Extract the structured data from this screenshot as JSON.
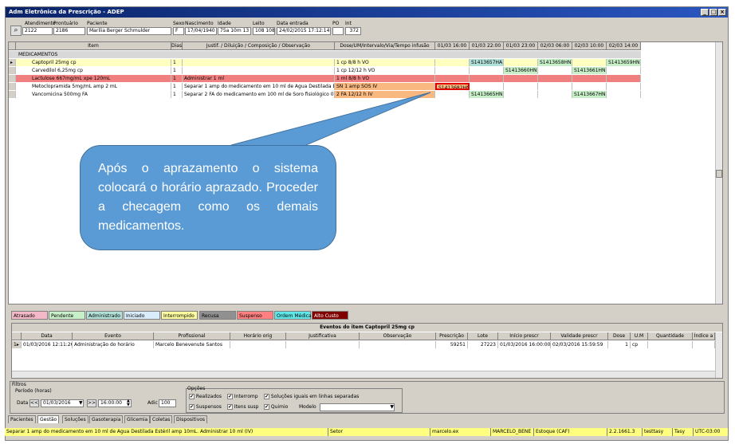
{
  "window": {
    "title": "Adm Eletrônica da Prescrição - ADEP"
  },
  "patient": {
    "labels": {
      "atendimento": "Atendimento",
      "prontuario": "Prontuário",
      "paciente": "Paciente",
      "sexo": "Sexo",
      "nascimento": "Nascimento",
      "idade": "Idade",
      "leito": "Leito",
      "data_entrada": "Data entrada",
      "po": "PO",
      "int": "Int"
    },
    "atendimento": "2122",
    "prontuario": "2186",
    "paciente": "Marilia Berger Schmulder",
    "sexo": "F",
    "nascimento": "17/04/1940",
    "idade": "75a 10m 13",
    "leito": "108 108",
    "data_entrada": "24/02/2015 17:12:14",
    "po": "",
    "int": "372"
  },
  "grid": {
    "columns": [
      "Item",
      "Dias",
      "Justif. / Diluição / Composição / Observação",
      "Dose/UM/Intervalo/Via/Tempo infusão",
      "01/03 16:00",
      "01/03 22:00",
      "01/03 23:00",
      "02/03 06:00",
      "02/03 10:00",
      "02/03 14:00"
    ],
    "group": "MEDICAMENTOS",
    "rows": [
      {
        "item": "Captopril 25mg cp",
        "dias": "1",
        "justif": "",
        "dose": "1 cp  8/8 h  VO",
        "h1": "",
        "h2": "S1413657HA",
        "h3": "",
        "h4": "S1413658HN",
        "h5": "",
        "h6": "S1413659HN"
      },
      {
        "item": "Carvedilol 6,25mg cp",
        "dias": "1",
        "justif": "",
        "dose": "1 cp  12/12 h  VO",
        "h1": "",
        "h2": "",
        "h3": "S1413660HN",
        "h4": "",
        "h5": "S1413661HN",
        "h6": ""
      },
      {
        "item": "Lactulose 667mg/mL xpe 120mL",
        "dias": "1",
        "justif": "Administrar 1 ml",
        "dose": "1 ml  8/8 h  VO",
        "h1": "",
        "h2": "",
        "h3": "",
        "h4": "",
        "h5": "",
        "h6": ""
      },
      {
        "item": "Metoclopramida 5mg/mL amp 2 mL",
        "dias": "1",
        "justif": "Separar 1 amp do medicamento em 10 ml de Agua Destilada Es",
        "dose": "SN 1 amp  SOS  IV",
        "h1": "S1413682HN",
        "h2": "",
        "h3": "",
        "h4": "",
        "h5": "",
        "h6": ""
      },
      {
        "item": "Vancomicina 500mg FA",
        "dias": "1",
        "justif": "Separar 2 FA do medicamento em 100 ml de Soro fisiológico 0,9",
        "dose": "2 FA  12/12 h  IV",
        "h1": "",
        "h2": "S1413665HN",
        "h3": "",
        "h4": "",
        "h5": "S1413667HN",
        "h6": ""
      }
    ]
  },
  "callout": {
    "text": "Após o aprazamento o sistema colocará o horário aprazado. Proceder a checagem como os demais medicamentos."
  },
  "legend": [
    {
      "label": "Atrasado",
      "color": "#f4b8c8"
    },
    {
      "label": "Pendente",
      "color": "#c8f0c8"
    },
    {
      "label": "Administrado",
      "color": "#b0e0d8"
    },
    {
      "label": "Iniciado",
      "color": "#d8ecfc"
    },
    {
      "label": "Interrompido",
      "color": "#ffffa0"
    },
    {
      "label": "Recusa",
      "color": "#909090"
    },
    {
      "label": "Suspenso",
      "color": "#ff8080"
    },
    {
      "label": "Ordem Médica",
      "color": "#60e8e8"
    },
    {
      "label": "Alto Custo",
      "color": "#800000"
    }
  ],
  "events": {
    "title": "Eventos do item Captopril 25mg cp",
    "columns": [
      "Data",
      "Evento",
      "Profissional",
      "Horário orig",
      "Justificativa",
      "Observação",
      "Prescrição",
      "Lote",
      "Início prescr",
      "Validade prescr",
      "Dose",
      "U.M",
      "Quantidade",
      "Índice a"
    ],
    "rows": [
      {
        "data": "01/03/2016 12:11:26",
        "evento": "Administração do horário",
        "profissional": "Marcelo Benevenute Santos",
        "horario": "",
        "justif": "",
        "obs": "",
        "prescricao": "59251",
        "lote": "27223",
        "inicio": "01/03/2016 16:00:00",
        "validade": "02/03/2016 15:59:59",
        "dose": "1",
        "um": "cp",
        "qtd": "",
        "indice": ""
      }
    ]
  },
  "filters": {
    "title": "Filtros",
    "period_label": "Período (horas)",
    "data_label": "Data",
    "date_value": "01/03/2016",
    "time_value": "16:00:00",
    "adic_label": "Adic",
    "adic_value": "100",
    "options_title": "Opções",
    "options": [
      {
        "label": "Realizados",
        "checked": true
      },
      {
        "label": "Interromp",
        "checked": true
      },
      {
        "label": "Soluções iguais em linhas separadas",
        "checked": true
      },
      {
        "label": "Suspensos",
        "checked": true
      },
      {
        "label": "Itens susp",
        "checked": true
      },
      {
        "label": "Quimio",
        "checked": true
      }
    ],
    "modelo_label": "Modelo"
  },
  "tabs": [
    "Pacientes",
    "Gestão",
    "Soluções",
    "Gasoterapia",
    "Glicemia",
    "Coletas",
    "Dispositivos"
  ],
  "status": [
    "Separar 1 amp do medicamento em 10 ml de Agua Destilada Estéril amp 10mL. Administrar 10 ml (IV)",
    "Setor",
    "marcelo.ex",
    "MARCELO_BENE",
    "Estoque (CAF)",
    "2.2.1661.3",
    "testtasy",
    "Tasy",
    "UTC-03:00"
  ],
  "nav": {
    "prev": "<<",
    "next": ">>"
  }
}
